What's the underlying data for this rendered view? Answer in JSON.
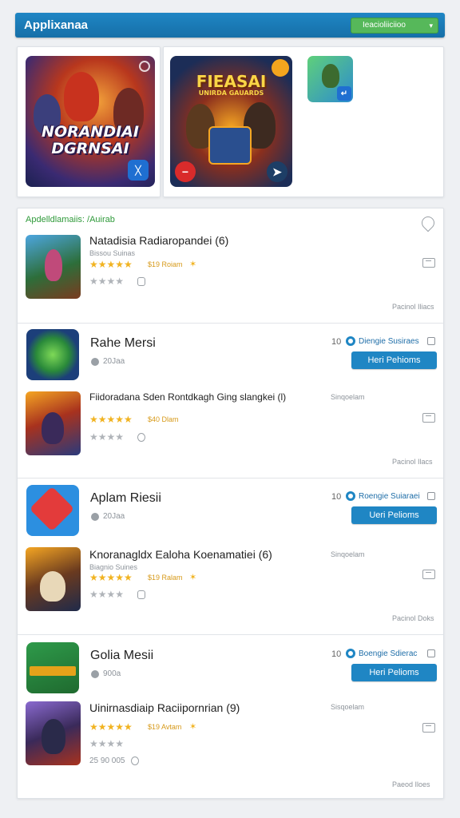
{
  "topbar": {
    "title": "Applixanaa",
    "button_label": "Ieacioliiciioo",
    "chevron": "▾"
  },
  "featured": {
    "banner1": {
      "line1": "NORANDIAI",
      "line2": "DGRNSAI"
    },
    "banner2": {
      "line1": "FIEASAI",
      "line2": "UNIRDA GAUARDS"
    }
  },
  "list": {
    "header": "Apdelldlamaiis: /Auirab",
    "items": [
      {
        "name": "Natadisia Radiaropandei (6)",
        "sub": "Bissou Suinas",
        "rating_label": "$19 Roiam",
        "foot": "Pacinol Iliacs"
      },
      {
        "name": "Rahe Mersi",
        "meta": "20Jaa",
        "count": "10",
        "option": "Diengie Susiraes",
        "button": "Heri Pehioms"
      },
      {
        "name": "Fiidoradana Sden Rontdkagh Ging slangkei (l)",
        "side": "Sinqoelam",
        "rating_label": "$40 Dlam",
        "foot": "Pacinol Ilacs"
      },
      {
        "name": "Aplam Riesii",
        "meta": "20Jaa",
        "count": "10",
        "option": "Roengie Suiaraei",
        "button": "Ueri Pelioms"
      },
      {
        "name": "Knoranagldx Ealoha Koenamatiei (6)",
        "sub": "Biagnio Suines",
        "side": "Sinqoelam",
        "rating_label": "$19 Ralam",
        "foot": "Pacinol Doks"
      },
      {
        "name": "Golia Mesii",
        "meta": "900a",
        "count": "10",
        "option": "Boengie Sdierac",
        "button": "Heri Pelioms"
      },
      {
        "name": "Uinirnasdiaip Raciipornrian (9)",
        "side": "Sisqoelam",
        "rating_label": "$19 Avtam",
        "gray_text": "25 90 005",
        "foot": "Paeod Iloes"
      }
    ]
  },
  "icons": [
    "compass-icon",
    "x-icon",
    "arrow-icon",
    "send-icon",
    "share-icon",
    "tag-icon",
    "clock-icon",
    "bookmark-icon"
  ],
  "colors": {
    "accent": "#1f86c4",
    "topbar_button": "#56b85a",
    "star": "#f1b321",
    "header_text": "#2f9a3a"
  }
}
